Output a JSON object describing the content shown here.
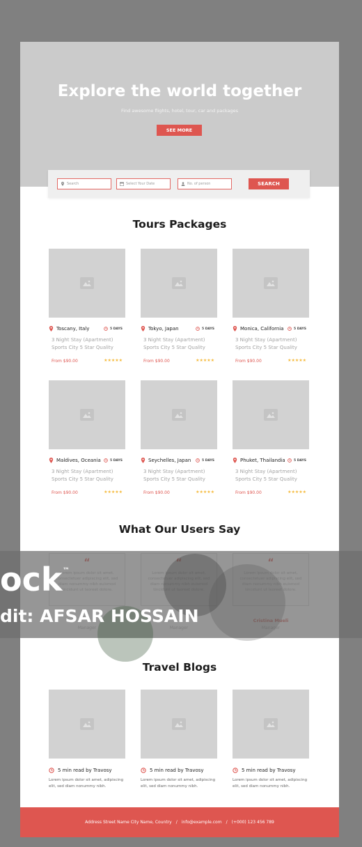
{
  "hero": {
    "title": "Explore the world together",
    "subtitle": "Find awesome flights, hotel, tour, car and packages",
    "button_label": "SEE MORE"
  },
  "search": {
    "search_placeholder": "Search",
    "date_placeholder": "Select Your Date",
    "persons_placeholder": "No. of person",
    "button_label": "SEARCH"
  },
  "tours": {
    "title": "Tours Packages",
    "items": [
      {
        "location": "Toscany, Italy",
        "days": "5 DAYS",
        "line1": "3 Night Stay (Apartment)",
        "line2": "Sports City 5 Star Quality",
        "price": "From $90.00",
        "stars": "★★★★★"
      },
      {
        "location": "Tokyo, Japan",
        "days": "5 DAYS",
        "line1": "3 Night Stay (Apartment)",
        "line2": "Sports City 5 Star Quality",
        "price": "From $90.00",
        "stars": "★★★★★"
      },
      {
        "location": "Monica, California",
        "days": "5 DAYS",
        "line1": "3 Night Stay (Apartment)",
        "line2": "Sports City 5 Star Quality",
        "price": "From $90.00",
        "stars": "★★★★★"
      },
      {
        "location": "Maldives, Oceania",
        "days": "5 DAYS",
        "line1": "3 Night Stay (Apartment)",
        "line2": "Sports City 5 Star Quality",
        "price": "From $90.00",
        "stars": "★★★★★"
      },
      {
        "location": "Seychelles, Japan",
        "days": "5 DAYS",
        "line1": "3 Night Stay (Apartment)",
        "line2": "Sports City 5 Star Quality",
        "price": "From $90.00",
        "stars": "★★★★★"
      },
      {
        "location": "Phuket, Thailandia",
        "days": "5 DAYS",
        "line1": "3 Night Stay (Apartment)",
        "line2": "Sports City 5 Star Quality",
        "price": "From $90.00",
        "stars": "★★★★★"
      }
    ]
  },
  "testimonials": {
    "title": "What Our Users Say",
    "quote_mark": "“",
    "items": [
      {
        "text": "Lorem ipsum dolor sit amet, consectetuer adipiscing elit, sed diam nonummy nibh euismod tincidunt ut laoreet dolore.",
        "name": "",
        "role": "Manager"
      },
      {
        "text": "Lorem ipsum dolor sit amet, consectetuer adipiscing elit, sed diam nonummy nibh euismod tincidunt ut laoreet dolore.",
        "name": "",
        "role": "Manager"
      },
      {
        "text": "Lorem ipsum dolor sit amet, consectetuer adipiscing elit, sed diam nonummy nibh euismod tincidunt ut laoreet dolore.",
        "name": "Cristina Mueli",
        "role": "Manager"
      }
    ]
  },
  "watermark": {
    "line1": "ock",
    "tm": "™",
    "line2": "dit: AFSAR HOSSAIN"
  },
  "blogs": {
    "title": "Travel Blogs",
    "items": [
      {
        "read": "5 min read by Travosy",
        "text": "Lorem ipsum dolor sit amet, adipiscing elit, sed diam nonummy nibh."
      },
      {
        "read": "5 min read by Travosy",
        "text": "Lorem ipsum dolor sit amet, adipiscing elit, sed diam nonummy nibh."
      },
      {
        "read": "5 min read by Travosy",
        "text": "Lorem ipsum dolor sit amet, adipiscing elit, sed diam nonummy nibh."
      }
    ]
  },
  "footer": {
    "address": "Address Street Name City Name, Country",
    "sep": "/",
    "email": "info@example.com",
    "phone": "(+000) 123 456 789"
  },
  "colors": {
    "accent": "#de5650",
    "star": "#f5b93a",
    "placeholder": "#d2d2d2"
  }
}
